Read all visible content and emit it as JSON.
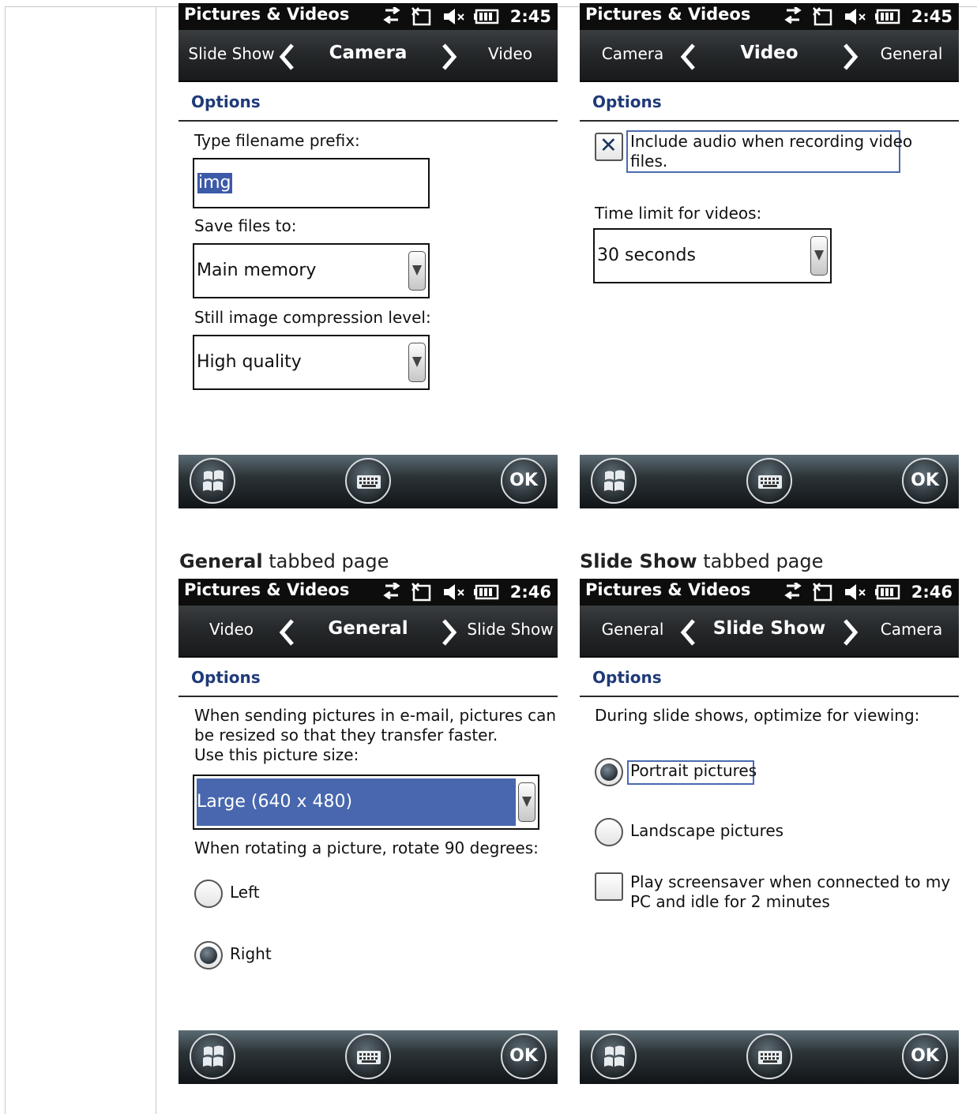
{
  "app_title": "Pictures & Videos",
  "options_heading": "Options",
  "ok_label": "OK",
  "captions": {
    "general": {
      "bold": "General",
      "rest": " tabbed page"
    },
    "slideshow": {
      "bold": "Slide Show",
      "rest": " tabbed page"
    }
  },
  "camera": {
    "time": "2:45",
    "tabs": {
      "prev": "Slide Show",
      "current": "Camera",
      "next": "Video"
    },
    "prefix_label": "Type filename prefix:",
    "prefix_value": "img",
    "save_label": "Save files to:",
    "save_value": "Main memory",
    "compression_label": "Still image compression level:",
    "compression_value": "High quality"
  },
  "video": {
    "time": "2:45",
    "tabs": {
      "prev": "Camera",
      "current": "Video",
      "next": "General"
    },
    "audio_line1": "Include audio when recording video",
    "audio_line2": "files.",
    "audio_checked": true,
    "time_limit_label": "Time limit for videos:",
    "time_limit_value": "30 seconds"
  },
  "general": {
    "time": "2:46",
    "tabs": {
      "prev": "Video",
      "current": "General",
      "next": "Slide Show"
    },
    "desc_line1": "When sending pictures in e-mail, pictures can",
    "desc_line2": "be resized so that they transfer faster.",
    "desc_line3": "Use this picture size:",
    "size_value": "Large (640 x 480)",
    "rotate_label": "When rotating a picture, rotate 90 degrees:",
    "left_label": "Left",
    "right_label": "Right",
    "selected": "Right"
  },
  "slideshow": {
    "time": "2:46",
    "tabs": {
      "prev": "General",
      "current": "Slide Show",
      "next": "Camera"
    },
    "optimize_label": "During slide shows, optimize for viewing:",
    "portrait_label": "Portrait pictures",
    "landscape_label": "Landscape pictures",
    "selected": "Portrait pictures",
    "screensaver_line1": "Play screensaver when connected to my",
    "screensaver_line2": "PC and idle for 2 minutes",
    "screensaver_checked": false
  },
  "icons": [
    "sync-icon",
    "no-signal-icon",
    "speaker-muted-icon",
    "battery-icon",
    "chevron-left-icon",
    "chevron-right-icon",
    "windows-start-icon",
    "keyboard-icon"
  ]
}
